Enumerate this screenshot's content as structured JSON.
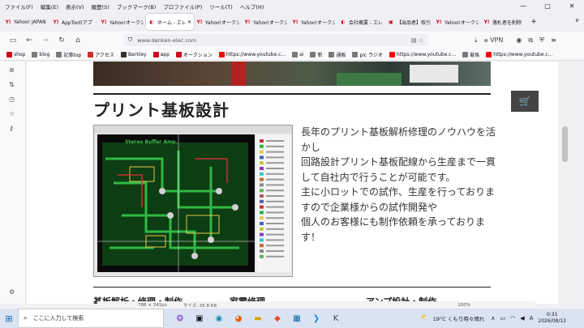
{
  "menu": [
    "ファイル(F)",
    "編集(E)",
    "表示(V)",
    "履歴(S)",
    "ブックマーク(B)",
    "プロファイル(P)",
    "ツール(T)",
    "ヘルプ(H)"
  ],
  "tabs": [
    {
      "title": "Yahoo! JAPAN",
      "icon": "Y!"
    },
    {
      "title": "AppTool(アプ",
      "icon": "Y!"
    },
    {
      "title": "Yahoo!オークシ",
      "icon": "Y!"
    },
    {
      "title": "ホーム - エレクト",
      "icon": "◐",
      "active": true
    },
    {
      "title": "Yahoo!オークシ",
      "icon": "Y!"
    },
    {
      "title": "Yahoo!オークシ",
      "icon": "Y!"
    },
    {
      "title": "Yahoo!オークシ",
      "icon": "Y!"
    },
    {
      "title": "会社概要 - エレク",
      "icon": "◐"
    },
    {
      "title": "【出品者】取引",
      "icon": "▣"
    },
    {
      "title": "Yahoo!オークシ",
      "icon": "Y!"
    },
    {
      "title": "落札者を削除",
      "icon": "Y!"
    }
  ],
  "url": "www.denken-elec.com",
  "vpn": "VPN",
  "bookmarks": [
    {
      "label": "shop",
      "color": "#d0021b"
    },
    {
      "label": "blog",
      "color": "#7a7a7a"
    },
    {
      "label": "記事top",
      "color": "#7a7a7a"
    },
    {
      "label": "アクセス",
      "color": "#c9302c"
    },
    {
      "label": "Barkley",
      "color": "#333"
    },
    {
      "label": "app",
      "color": "#d0021b"
    },
    {
      "label": "オークション",
      "color": "#d0021b"
    },
    {
      "label": "https://www.youtube.c...",
      "color": "#ff0000"
    },
    {
      "label": "ai",
      "color": "#7a7a7a"
    },
    {
      "label": "新",
      "color": "#7a7a7a"
    },
    {
      "label": "通販",
      "color": "#7a7a7a"
    },
    {
      "label": "pic ラジオ",
      "color": "#7a7a7a"
    },
    {
      "label": "https://www.youtube.c...",
      "color": "#ff0000"
    },
    {
      "label": "競馬",
      "color": "#7a7a7a"
    },
    {
      "label": "https://www.youtube.c...",
      "color": "#ff0000"
    }
  ],
  "page": {
    "heading": "プリント基板設計",
    "pcb_label": "Stereo Buffer Amp.",
    "description": "長年のプリント基板解析修理のノウハウを活かし\n回路設計プリント基板配線から生産まで一貫して自社内で行うことが可能です。\n主に小ロットでの試作、生産を行っておりますので企業様からの試作開発や\n個人のお客様にも制作依頼を承っております！",
    "next_headings": [
      "基板解析・修理・制作",
      "家電修理",
      "アンプ設計・制作"
    ]
  },
  "status": {
    "dims": "788 × 341px",
    "size": "サイズ: 35.8 KB",
    "zoom": "100%"
  },
  "taskbar": {
    "search_placeholder": "ここに入力して検索",
    "weather": "19°C くもり時々晴れ",
    "time": "0:31",
    "date": "2026/08/13"
  },
  "colors": {
    "accent": "#0a64ad",
    "heading": "#222222",
    "cart_bg": "#444444"
  }
}
